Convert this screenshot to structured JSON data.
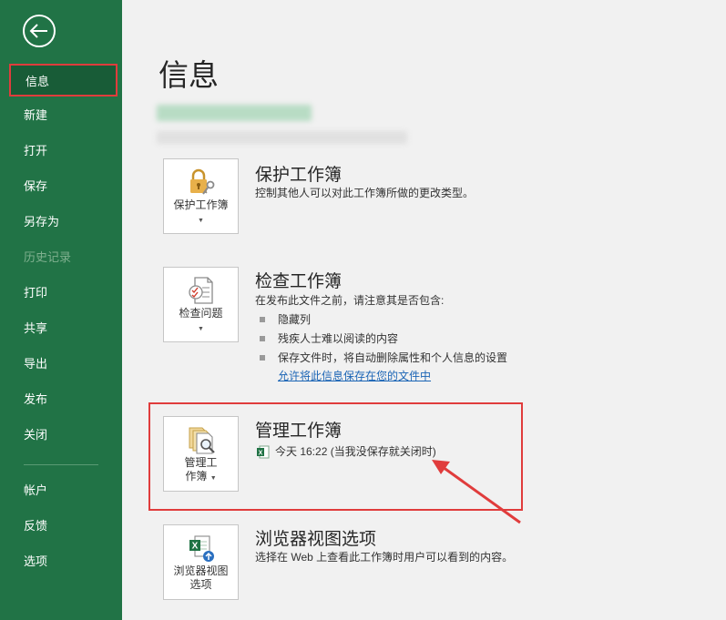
{
  "sidebar": {
    "back_icon": "back-arrow-icon",
    "items": [
      {
        "label": "信息",
        "active": true
      },
      {
        "label": "新建"
      },
      {
        "label": "打开"
      },
      {
        "label": "保存"
      },
      {
        "label": "另存为"
      },
      {
        "label": "历史记录",
        "disabled": true
      },
      {
        "label": "打印"
      },
      {
        "label": "共享"
      },
      {
        "label": "导出"
      },
      {
        "label": "发布"
      },
      {
        "label": "关闭"
      },
      {
        "label": "帐户"
      },
      {
        "label": "反馈"
      },
      {
        "label": "选项"
      }
    ]
  },
  "main": {
    "title": "信息",
    "protect": {
      "tile_label": "保护工作簿",
      "title": "保护工作簿",
      "desc": "控制其他人可以对此工作簿所做的更改类型。"
    },
    "inspect": {
      "tile_label": "检查问题",
      "title": "检查工作簿",
      "desc": "在发布此文件之前，请注意其是否包含:",
      "bullets": [
        "隐藏列",
        "残疾人士难以阅读的内容",
        "保存文件时，将自动删除属性和个人信息的设置"
      ],
      "link": "允许将此信息保存在您的文件中"
    },
    "manage": {
      "tile_label_1": "管理工",
      "tile_label_2": "作簿",
      "title": "管理工作簿",
      "version": "今天 16:22 (当我没保存就关闭时)"
    },
    "browser": {
      "tile_label_1": "浏览器视图",
      "tile_label_2": "选项",
      "title": "浏览器视图选项",
      "desc": "选择在 Web 上查看此工作簿时用户可以看到的内容。"
    }
  },
  "colors": {
    "sidebar": "#217346",
    "sidebar_active": "#185c37",
    "highlight": "#e03c3c",
    "link": "#1a64b5"
  }
}
